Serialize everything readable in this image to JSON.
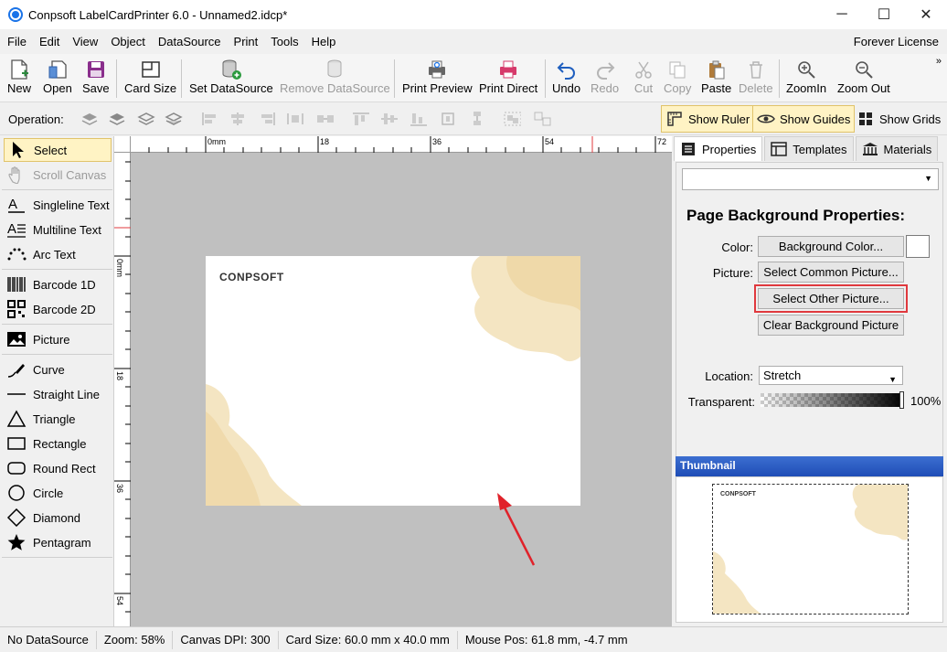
{
  "window": {
    "title": "Conpsoft LabelCardPrinter 6.0 - Unnamed2.idcp*",
    "minimize": "─",
    "maximize": "☐",
    "close": "✕"
  },
  "menu": [
    "File",
    "Edit",
    "View",
    "Object",
    "DataSource",
    "Print",
    "Tools",
    "Help"
  ],
  "license": "Forever License",
  "toolbar": {
    "new": "New",
    "open": "Open",
    "save": "Save",
    "card_size": "Card Size",
    "set_datasource": "Set DataSource",
    "remove_datasource": "Remove DataSource",
    "print_preview": "Print Preview",
    "print_direct": "Print Direct",
    "undo": "Undo",
    "redo": "Redo",
    "cut": "Cut",
    "copy": "Copy",
    "paste": "Paste",
    "delete": "Delete",
    "zoom_in": "ZoomIn",
    "zoom_out": "Zoom Out",
    "more": "»"
  },
  "operation_bar": {
    "label": "Operation:",
    "show_ruler": "Show Ruler",
    "show_guides": "Show Guides",
    "show_grids": "Show Grids"
  },
  "tools": [
    "Select",
    "Scroll Canvas",
    "Singleline Text",
    "Multiline Text",
    "Arc Text",
    "Barcode 1D",
    "Barcode 2D",
    "Picture",
    "Curve",
    "Straight Line",
    "Triangle",
    "Rectangle",
    "Round Rect",
    "Circle",
    "Diamond",
    "Pentagram"
  ],
  "ruler": {
    "h_unit": "0mm",
    "h_marks": [
      "18",
      "36",
      "54",
      "72"
    ],
    "v_unit": "0mm",
    "v_marks": [
      "18",
      "36",
      "54"
    ]
  },
  "card": {
    "logo": "CONPSOFT"
  },
  "panel": {
    "tabs": [
      "Properties",
      "Templates",
      "Materials"
    ],
    "section_title": "Page Background Properties:",
    "color_label": "Color:",
    "background_color_button": "Background Color...",
    "picture_label": "Picture:",
    "select_common_button": "Select Common Picture...",
    "select_other_button": "Select Other Picture...",
    "clear_background_button": "Clear Background Picture",
    "location_label": "Location:",
    "location_value": "Stretch",
    "transparent_label": "Transparent:",
    "transparent_value": "100%",
    "thumbnail_title": "Thumbnail",
    "thumbnail_logo": "CONPSOFT"
  },
  "status": {
    "datasource": "No DataSource",
    "zoom": "Zoom: 58%",
    "dpi": "Canvas DPI: 300",
    "card_size": "Card Size: 60.0 mm x 40.0 mm",
    "mouse_pos": "Mouse Pos: 61.8 mm, -4.7 mm"
  },
  "colors": {
    "accent": "#1a73e8",
    "highlight_outline": "#e0393e",
    "toggle_active": "#fff3c4",
    "canvas_bg": "#c0c0c0",
    "watercolor": "#f0dcae",
    "thumbnail_header": "#2a5cc3"
  }
}
